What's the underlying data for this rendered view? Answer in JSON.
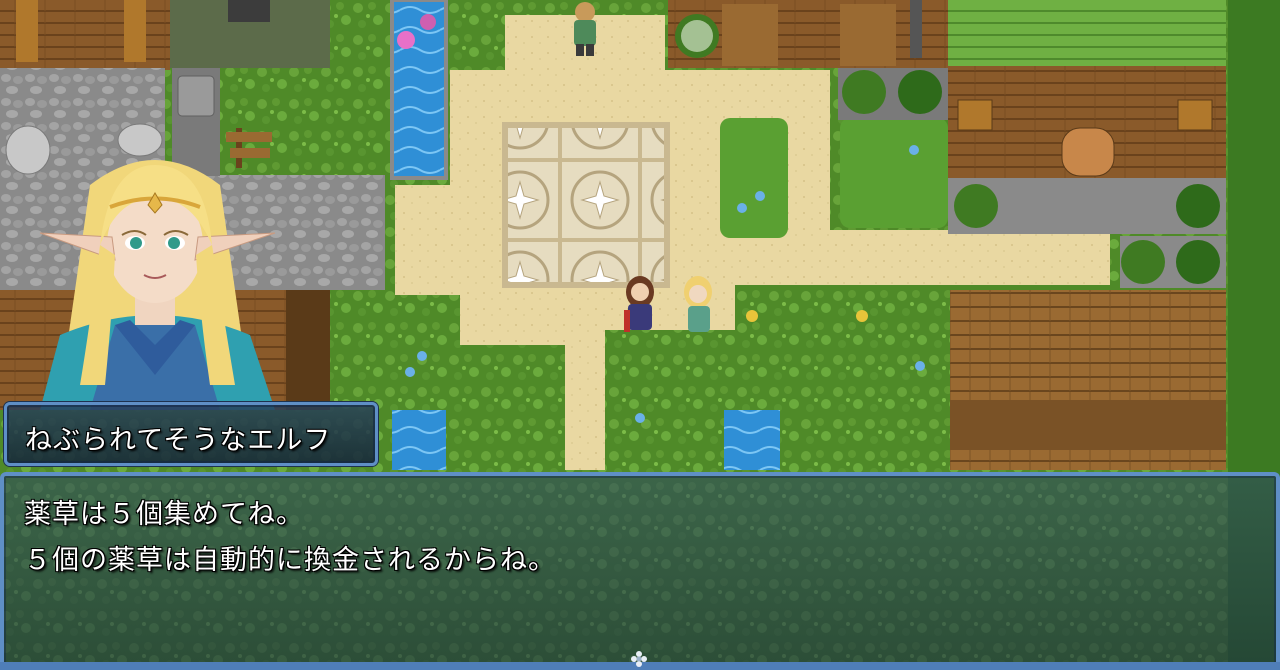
{
  "dialog": {
    "speaker_name": "ねぶられてそうなエルフ",
    "lines": [
      "薬草は５個集めてね。",
      "５個の薬草は自動的に換金されるからね。"
    ]
  },
  "icons": {
    "continue": "flower-cursor-icon"
  },
  "colors": {
    "window_border": "#5f8fc6",
    "window_bg": "#1c3452",
    "text": "#ffffff"
  }
}
